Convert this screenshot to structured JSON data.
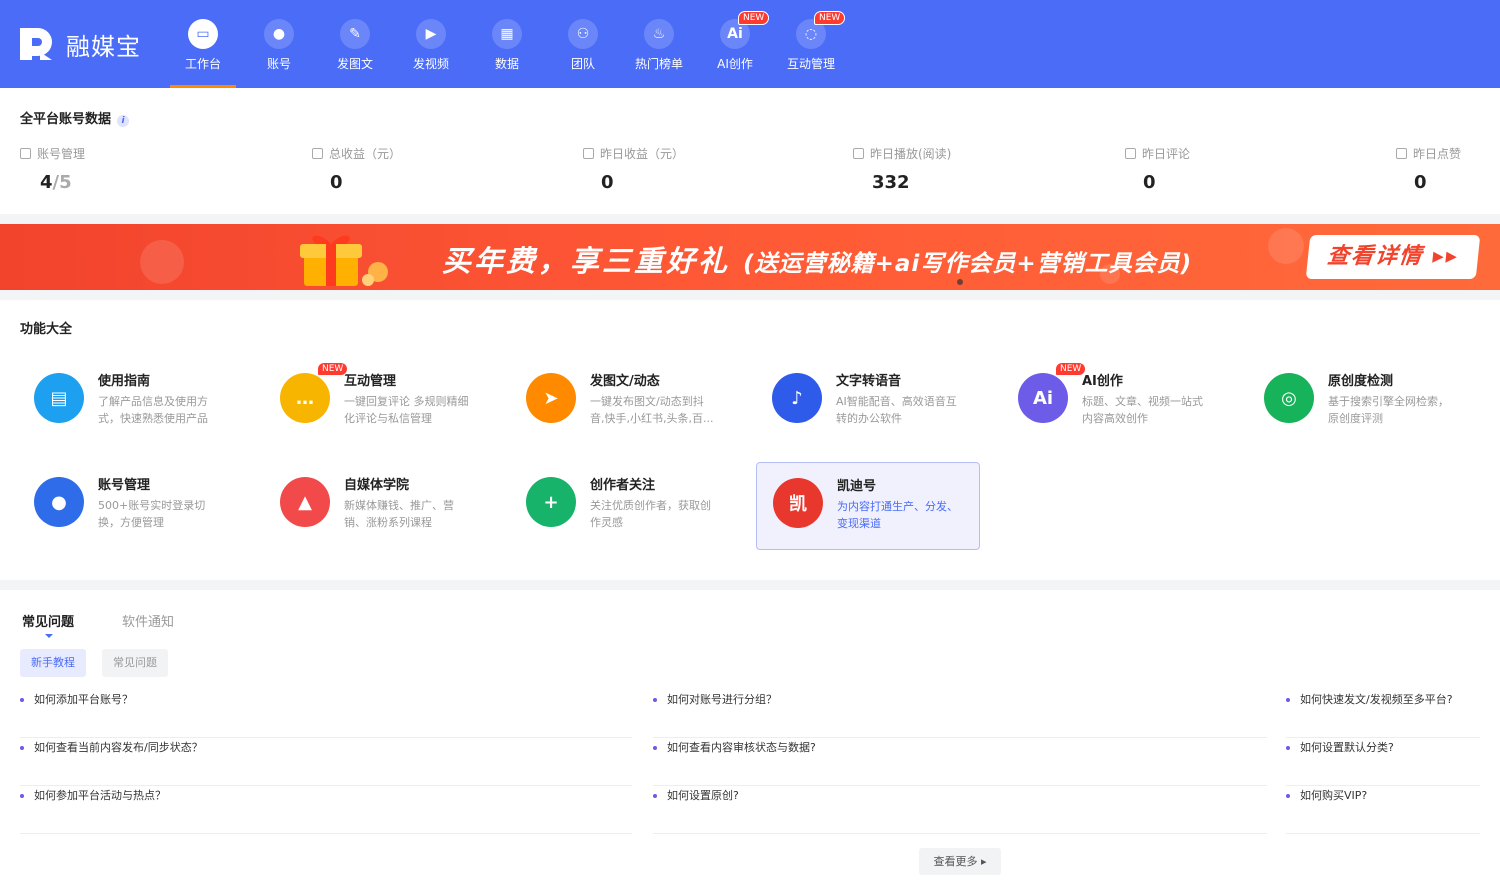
{
  "app": {
    "name": "融媒宝",
    "brand_color": "#4a6cf7",
    "accent_color": "#ff8a00"
  },
  "nav": [
    {
      "label": "工作台",
      "icon": "monitor-icon",
      "active": true
    },
    {
      "label": "账号",
      "icon": "user-icon"
    },
    {
      "label": "发图文",
      "icon": "feather-icon"
    },
    {
      "label": "发视频",
      "icon": "play-icon"
    },
    {
      "label": "数据",
      "icon": "chart-icon"
    },
    {
      "label": "团队",
      "icon": "team-icon"
    },
    {
      "label": "热门榜单",
      "icon": "flame-icon"
    },
    {
      "label": "AI创作",
      "icon": "ai-icon",
      "badge": "NEW"
    },
    {
      "label": "互动管理",
      "icon": "chat-icon",
      "badge": "NEW"
    }
  ],
  "stats": {
    "title": "全平台账号数据",
    "info": "i",
    "items": [
      {
        "label": "账号管理",
        "value": "4",
        "value_total": "/5"
      },
      {
        "label": "总收益（元）",
        "value": "0"
      },
      {
        "label": "昨日收益（元）",
        "value": "0"
      },
      {
        "label": "昨日播放(阅读)",
        "value": "332"
      },
      {
        "label": "昨日评论",
        "value": "0"
      },
      {
        "label": "昨日点赞",
        "value": "0"
      }
    ]
  },
  "banner": {
    "headline": "买年费，享三重好礼",
    "sub": "(送运营秘籍+ai写作会员+营销工具会员)",
    "button": "查看详情 ▸▸"
  },
  "features": {
    "title": "功能大全",
    "items": [
      {
        "title": "使用指南",
        "desc": "了解产品信息及使用方式，快速熟悉使用产品",
        "icon": "book-icon",
        "color": "#1ea0f0",
        "glyph": "▤"
      },
      {
        "title": "互动管理",
        "desc": "一键回复评论 多规则精细化评论与私信管理",
        "icon": "chat-icon",
        "color": "#f7b500",
        "glyph": "…",
        "badge": "NEW"
      },
      {
        "title": "发图文/动态",
        "desc": "一键发布图文/动态到抖音,快手,小红书,头条,百...",
        "icon": "paper-plane-icon",
        "color": "#ff8a00",
        "glyph": "➤"
      },
      {
        "title": "文字转语音",
        "desc": "AI智能配音、高效语音互转的办公软件",
        "icon": "voice-icon",
        "color": "#2f5bea",
        "glyph": "♪"
      },
      {
        "title": "AI创作",
        "desc": "标题、文章、视频一站式内容高效创作",
        "icon": "ai-icon",
        "color": "#6d5ce7",
        "glyph": "Ai",
        "badge": "NEW"
      },
      {
        "title": "原创度检测",
        "desc": "基于搜索引擎全网检索，原创度评测",
        "icon": "target-icon",
        "color": "#17b35a",
        "glyph": "◎"
      },
      {
        "title": "账号管理",
        "desc": "500+账号实时登录切换，方便管理",
        "icon": "user-icon",
        "color": "#2f6cea",
        "glyph": "●"
      },
      {
        "title": "自媒体学院",
        "desc": "新媒体赚钱、推广、营销、涨粉系列课程",
        "icon": "graduation-cap-icon",
        "color": "#f24a4a",
        "glyph": "▲"
      },
      {
        "title": "创作者关注",
        "desc": "关注优质创作者，获取创作灵感",
        "icon": "add-user-icon",
        "color": "#17b36a",
        "glyph": "+"
      },
      {
        "title": "凯迪号",
        "desc": "为内容打通生产、分发、变现渠道",
        "icon": "kaidi-logo-icon",
        "color": "#e8372c",
        "glyph": "凯",
        "highlight": true
      }
    ]
  },
  "faq": {
    "tabs": [
      "常见问题",
      "软件通知"
    ],
    "pills": [
      "新手教程",
      "常见问题"
    ],
    "columns": [
      [
        "如何添加平台账号？",
        "如何查看当前内容发布/同步状态？",
        "如何参加平台活动与热点？"
      ],
      [
        "如何对账号进行分组？",
        "如何查看内容审核状态与数据?",
        "如何设置原创?"
      ],
      [
        "如何快速发文/发视频至多平台?",
        "如何设置默认分类?",
        "如何购买VIP?"
      ]
    ],
    "more": "查看更多 ▸"
  }
}
